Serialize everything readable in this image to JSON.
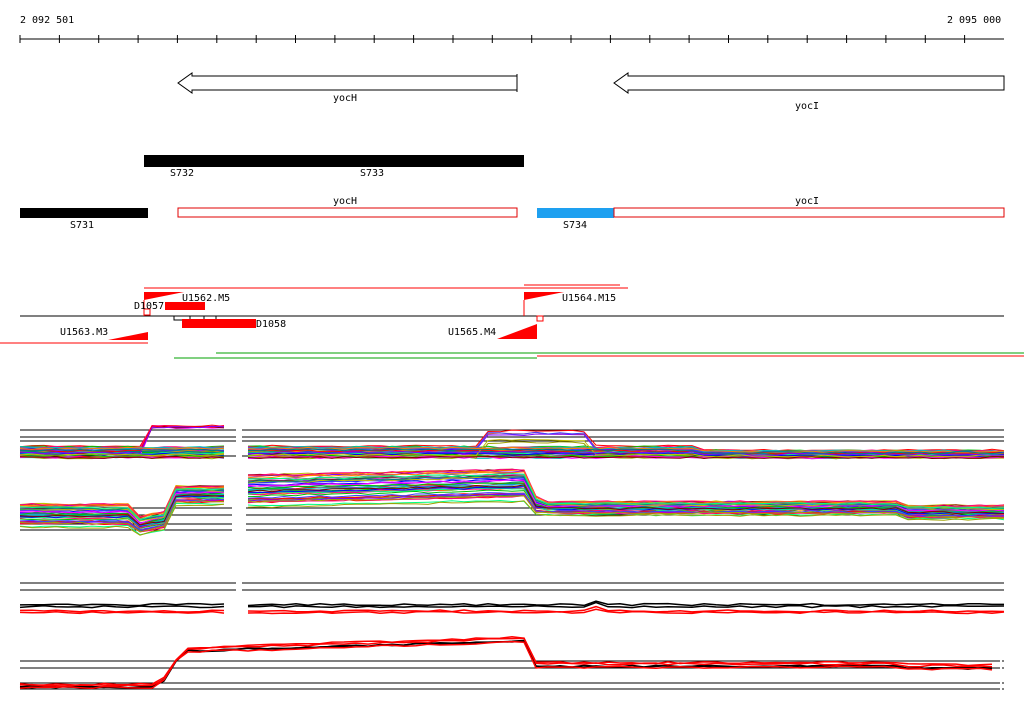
{
  "coordinates": {
    "start": "2 092 501",
    "end": "2 095 000"
  },
  "genes": [
    {
      "name": "yocH",
      "strand": "minus"
    },
    {
      "name": "yocI",
      "strand": "minus"
    }
  ],
  "segments": [
    {
      "label": "S732",
      "color": "#000000"
    },
    {
      "label": "S733",
      "color": "#000000"
    },
    {
      "label": "S731",
      "color": "#000000"
    },
    {
      "label": "S734",
      "color": "#1ea0f0"
    }
  ],
  "transcripts": [
    {
      "label": "yocH",
      "color": "#e00000"
    },
    {
      "label": "yocI",
      "color": "#e00000"
    }
  ],
  "features": [
    {
      "label": "D1057"
    },
    {
      "label": "U1562.M5"
    },
    {
      "label": "U1564.M15"
    },
    {
      "label": "D1058"
    },
    {
      "label": "U1563.M3"
    },
    {
      "label": "U1565.M4"
    }
  ],
  "colors": {
    "feature": "#ff0000",
    "reference_line": "#000000",
    "green_line": "#00a000"
  }
}
